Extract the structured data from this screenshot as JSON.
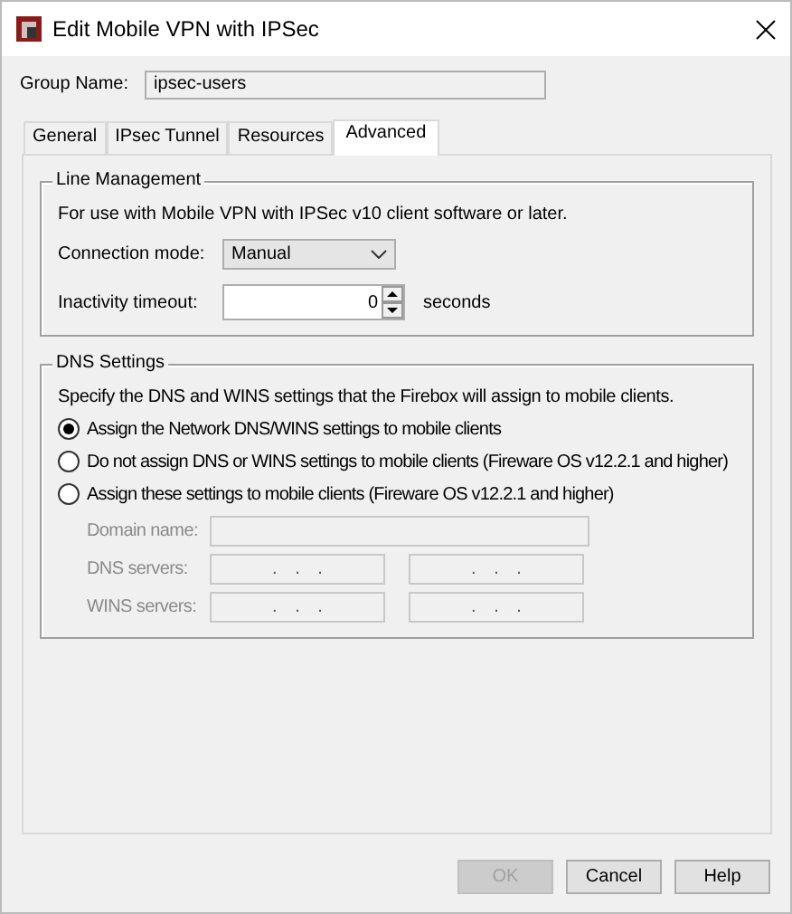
{
  "window": {
    "title": "Edit Mobile VPN with IPSec"
  },
  "group_name": {
    "label": "Group Name:",
    "value": "ipsec-users"
  },
  "tabs": [
    {
      "label": "General",
      "selected": false
    },
    {
      "label": "IPsec Tunnel",
      "selected": false
    },
    {
      "label": "Resources",
      "selected": false
    },
    {
      "label": "Advanced",
      "selected": true
    }
  ],
  "line_management": {
    "title": "Line Management",
    "note": "For use with Mobile VPN with IPSec v10 client software or later.",
    "connection_mode": {
      "label": "Connection mode:",
      "value": "Manual"
    },
    "inactivity_timeout": {
      "label": "Inactivity timeout:",
      "value": "0",
      "unit": "seconds"
    }
  },
  "dns_settings": {
    "title": "DNS Settings",
    "note": "Specify the DNS and WINS settings that the Firebox will assign to mobile clients.",
    "options": [
      {
        "label": "Assign the Network DNS/WINS settings to mobile clients",
        "selected": true
      },
      {
        "label": "Do not assign DNS or WINS settings to mobile clients (Fireware OS v12.2.1 and higher)",
        "selected": false
      },
      {
        "label": "Assign these settings to mobile clients (Fireware OS v12.2.1 and higher)",
        "selected": false
      }
    ],
    "disabled": true,
    "domain_name": {
      "label": "Domain name:"
    },
    "dns_servers": {
      "label": "DNS servers:",
      "fields": [
        ". . .",
        ". . ."
      ]
    },
    "wins_servers": {
      "label": "WINS servers:",
      "fields": [
        ". . .",
        ". . ."
      ]
    }
  },
  "buttons": [
    {
      "label": "OK",
      "disabled": true
    },
    {
      "label": "Cancel",
      "disabled": false
    },
    {
      "label": "Help",
      "disabled": false
    }
  ]
}
